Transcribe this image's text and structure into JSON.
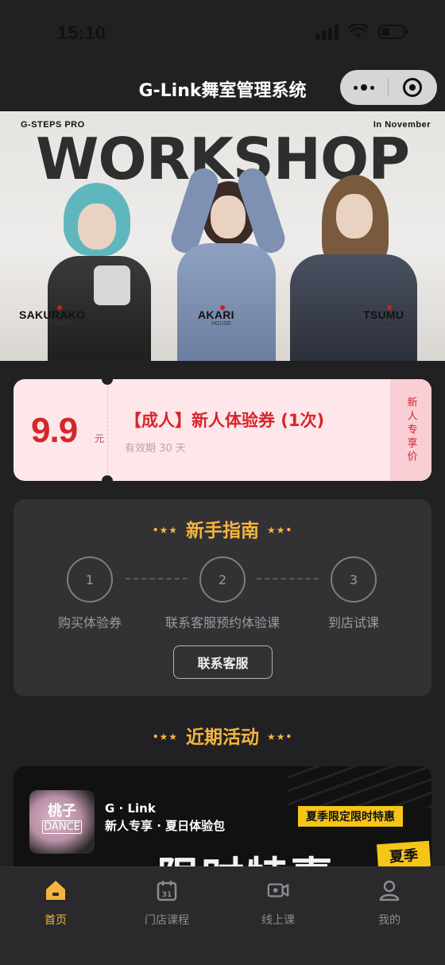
{
  "status_bar": {
    "time": "15:10"
  },
  "nav": {
    "title": "G-Link舞室管理系统"
  },
  "banner": {
    "top_left": "G-STEPS PRO",
    "top_right": "In November",
    "headline": "WORKSHOP",
    "dancers": [
      {
        "name": "SAKURAKO",
        "genre": "HIPHOP"
      },
      {
        "name": "AKARI",
        "genre": "HOUSE"
      },
      {
        "name": "TSUMU",
        "genre": "HOUSE"
      }
    ]
  },
  "coupon": {
    "price": "9.9",
    "unit": "元",
    "title": "【成人】新人体验券 (1次)",
    "validity": "有效期 30 天",
    "tag": "新人专享价"
  },
  "guide": {
    "title": "新手指南",
    "steps": [
      {
        "num": "1",
        "label": "购买体验券"
      },
      {
        "num": "2",
        "label": "联系客服预约体验课"
      },
      {
        "num": "3",
        "label": "到店试课"
      }
    ],
    "contact_button": "联系客服"
  },
  "activity": {
    "title": "近期活动",
    "promo": {
      "logo_line1": "桃子",
      "logo_line2": "DANCE",
      "brand": "G · Link",
      "subtitle": "新人专享 · 夏日体验包",
      "badge": "夏季限定限时特惠",
      "big_text": "限时特惠",
      "summer_tag": "夏季"
    }
  },
  "tab_bar": {
    "items": [
      {
        "label": "首页",
        "icon": "home-icon",
        "active": true
      },
      {
        "label": "门店课程",
        "icon": "calendar-icon",
        "active": false
      },
      {
        "label": "线上课",
        "icon": "video-icon",
        "active": false
      },
      {
        "label": "我的",
        "icon": "user-icon",
        "active": false
      }
    ]
  },
  "colors": {
    "accent": "#f5b440",
    "coupon_red": "#d4262c",
    "background": "#212123",
    "card": "#323234"
  }
}
